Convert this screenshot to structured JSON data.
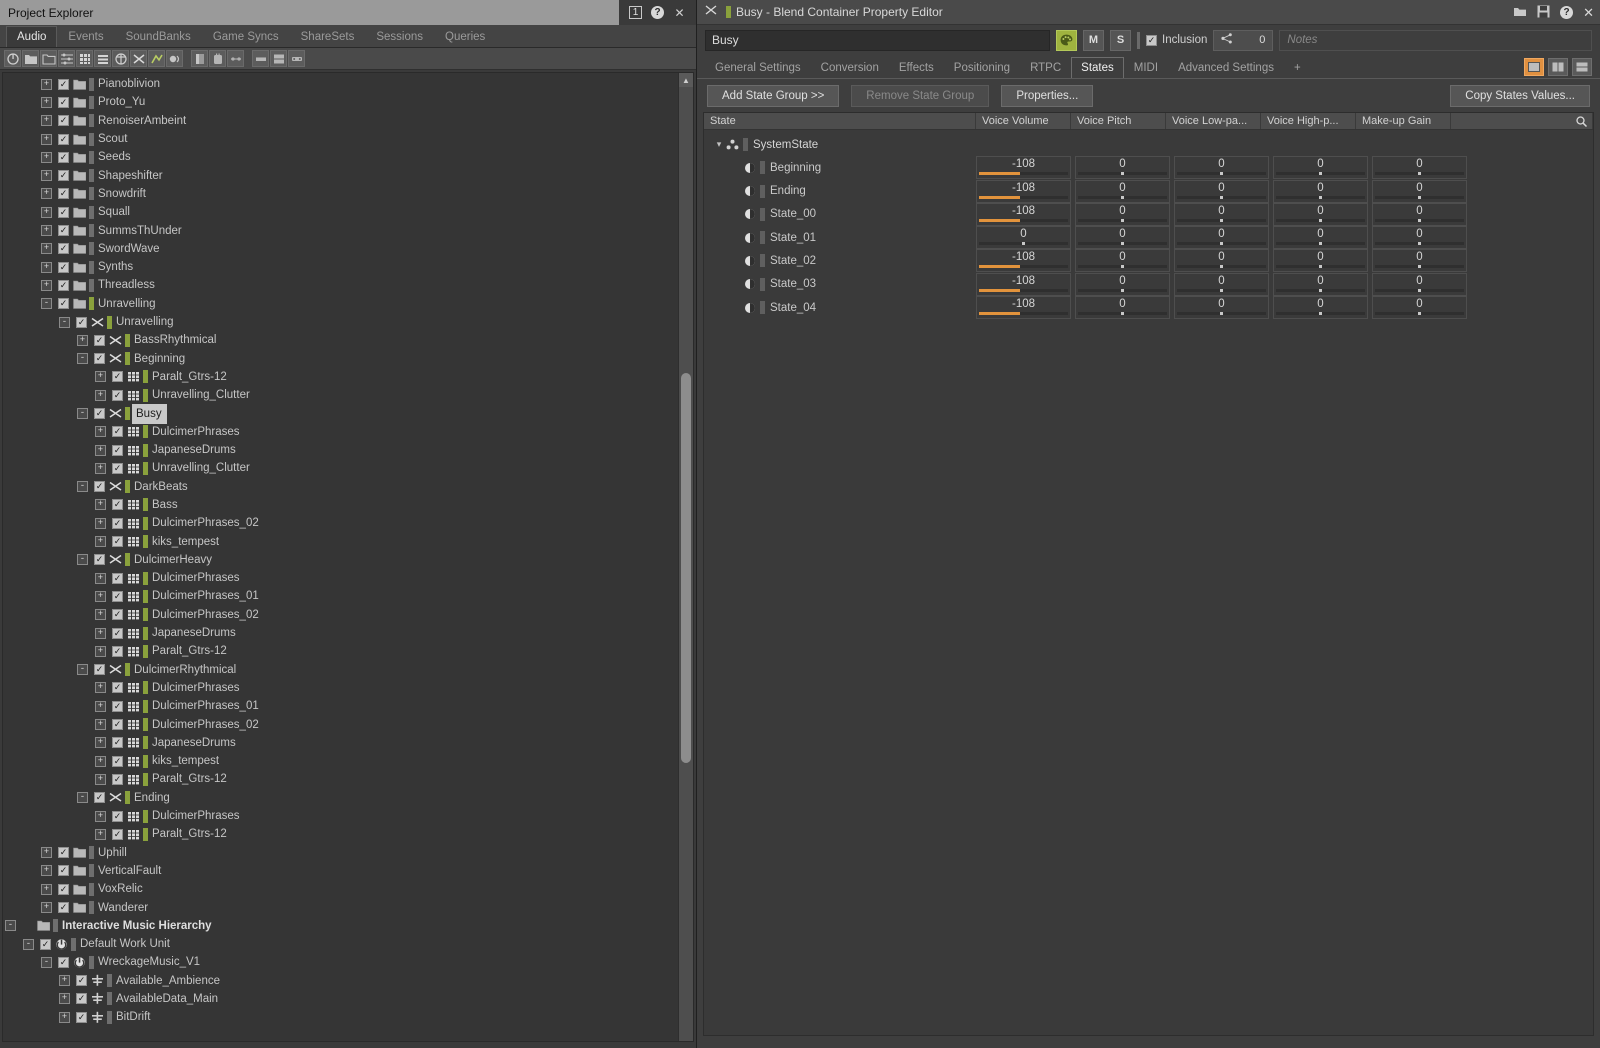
{
  "project_explorer": {
    "title": "Project Explorer",
    "window_buttons": [
      {
        "name": "pin-number-button",
        "label": "1"
      },
      {
        "name": "help-button",
        "label": "?"
      },
      {
        "name": "close-button",
        "label": "✕"
      }
    ],
    "tabs": [
      {
        "label": "Audio",
        "active": true
      },
      {
        "label": "Events",
        "active": false
      },
      {
        "label": "SoundBanks",
        "active": false
      },
      {
        "label": "Game Syncs",
        "active": false
      },
      {
        "label": "ShareSets",
        "active": false
      },
      {
        "label": "Sessions",
        "active": false
      },
      {
        "label": "Queries",
        "active": false
      }
    ],
    "toolbar": [
      "power-icon",
      "folder-icon",
      "folder-new-icon",
      "mixer-icon",
      "grid-icon",
      "list-icon",
      "random-container-icon",
      "blend-container-icon",
      "switch-container-icon",
      "actor-mixer-icon",
      "sep",
      "bus-icon",
      "aux-bus-icon",
      "motion-icon",
      "sep2",
      "soundcaster-icon",
      "layout-icon",
      "game-object-icon"
    ],
    "tree": [
      {
        "label": "Pianoblivion",
        "depth": 3,
        "exp": "+",
        "check": true,
        "icon": "folder",
        "bar": "grey"
      },
      {
        "label": "Proto_Yu",
        "depth": 3,
        "exp": "+",
        "check": true,
        "icon": "folder",
        "bar": "grey"
      },
      {
        "label": "RenoiserAmbeint",
        "depth": 3,
        "exp": "+",
        "check": true,
        "icon": "folder",
        "bar": "grey"
      },
      {
        "label": "Scout",
        "depth": 3,
        "exp": "+",
        "check": true,
        "icon": "folder",
        "bar": "grey"
      },
      {
        "label": "Seeds",
        "depth": 3,
        "exp": "+",
        "check": true,
        "icon": "folder",
        "bar": "grey"
      },
      {
        "label": "Shapeshifter",
        "depth": 3,
        "exp": "+",
        "check": true,
        "icon": "folder",
        "bar": "grey"
      },
      {
        "label": "Snowdrift",
        "depth": 3,
        "exp": "+",
        "check": true,
        "icon": "folder",
        "bar": "grey"
      },
      {
        "label": "Squall",
        "depth": 3,
        "exp": "+",
        "check": true,
        "icon": "folder",
        "bar": "grey"
      },
      {
        "label": "SummsThUnder",
        "depth": 3,
        "exp": "+",
        "check": true,
        "icon": "folder",
        "bar": "grey"
      },
      {
        "label": "SwordWave",
        "depth": 3,
        "exp": "+",
        "check": true,
        "icon": "folder",
        "bar": "grey"
      },
      {
        "label": "Synths",
        "depth": 3,
        "exp": "+",
        "check": true,
        "icon": "folder",
        "bar": "grey"
      },
      {
        "label": "Threadless",
        "depth": 3,
        "exp": "+",
        "check": true,
        "icon": "folder",
        "bar": "grey"
      },
      {
        "label": "Unravelling",
        "depth": 3,
        "exp": "-",
        "check": true,
        "icon": "folder",
        "bar": "green"
      },
      {
        "label": "Unravelling",
        "depth": 4,
        "exp": "-",
        "check": true,
        "icon": "blend",
        "bar": "green"
      },
      {
        "label": "BassRhythmical",
        "depth": 5,
        "exp": "+",
        "check": true,
        "icon": "blend",
        "bar": "green"
      },
      {
        "label": "Beginning",
        "depth": 5,
        "exp": "-",
        "check": true,
        "icon": "blend",
        "bar": "green"
      },
      {
        "label": "Paralt_Gtrs-12",
        "depth": 6,
        "exp": "+",
        "check": true,
        "icon": "sound",
        "bar": "green"
      },
      {
        "label": "Unravelling_Clutter",
        "depth": 6,
        "exp": "+",
        "check": true,
        "icon": "sound",
        "bar": "green"
      },
      {
        "label": "Busy",
        "depth": 5,
        "exp": "-",
        "check": true,
        "icon": "blend",
        "bar": "green",
        "selected": true
      },
      {
        "label": "DulcimerPhrases",
        "depth": 6,
        "exp": "+",
        "check": true,
        "icon": "sound",
        "bar": "green"
      },
      {
        "label": "JapaneseDrums",
        "depth": 6,
        "exp": "+",
        "check": true,
        "icon": "sound",
        "bar": "green"
      },
      {
        "label": "Unravelling_Clutter",
        "depth": 6,
        "exp": "+",
        "check": true,
        "icon": "sound",
        "bar": "green"
      },
      {
        "label": "DarkBeats",
        "depth": 5,
        "exp": "-",
        "check": true,
        "icon": "blend",
        "bar": "green"
      },
      {
        "label": "Bass",
        "depth": 6,
        "exp": "+",
        "check": true,
        "icon": "sound",
        "bar": "green"
      },
      {
        "label": "DulcimerPhrases_02",
        "depth": 6,
        "exp": "+",
        "check": true,
        "icon": "sound",
        "bar": "green"
      },
      {
        "label": "kiks_tempest",
        "depth": 6,
        "exp": "+",
        "check": true,
        "icon": "sound",
        "bar": "green"
      },
      {
        "label": "DulcimerHeavy",
        "depth": 5,
        "exp": "-",
        "check": true,
        "icon": "blend",
        "bar": "green"
      },
      {
        "label": "DulcimerPhrases",
        "depth": 6,
        "exp": "+",
        "check": true,
        "icon": "sound",
        "bar": "green"
      },
      {
        "label": "DulcimerPhrases_01",
        "depth": 6,
        "exp": "+",
        "check": true,
        "icon": "sound",
        "bar": "green"
      },
      {
        "label": "DulcimerPhrases_02",
        "depth": 6,
        "exp": "+",
        "check": true,
        "icon": "sound",
        "bar": "green"
      },
      {
        "label": "JapaneseDrums",
        "depth": 6,
        "exp": "+",
        "check": true,
        "icon": "sound",
        "bar": "green"
      },
      {
        "label": "Paralt_Gtrs-12",
        "depth": 6,
        "exp": "+",
        "check": true,
        "icon": "sound",
        "bar": "green"
      },
      {
        "label": "DulcimerRhythmical",
        "depth": 5,
        "exp": "-",
        "check": true,
        "icon": "blend",
        "bar": "green"
      },
      {
        "label": "DulcimerPhrases",
        "depth": 6,
        "exp": "+",
        "check": true,
        "icon": "sound",
        "bar": "green"
      },
      {
        "label": "DulcimerPhrases_01",
        "depth": 6,
        "exp": "+",
        "check": true,
        "icon": "sound",
        "bar": "green"
      },
      {
        "label": "DulcimerPhrases_02",
        "depth": 6,
        "exp": "+",
        "check": true,
        "icon": "sound",
        "bar": "green"
      },
      {
        "label": "JapaneseDrums",
        "depth": 6,
        "exp": "+",
        "check": true,
        "icon": "sound",
        "bar": "green"
      },
      {
        "label": "kiks_tempest",
        "depth": 6,
        "exp": "+",
        "check": true,
        "icon": "sound",
        "bar": "green"
      },
      {
        "label": "Paralt_Gtrs-12",
        "depth": 6,
        "exp": "+",
        "check": true,
        "icon": "sound",
        "bar": "green"
      },
      {
        "label": "Ending",
        "depth": 5,
        "exp": "-",
        "check": true,
        "icon": "blend",
        "bar": "green"
      },
      {
        "label": "DulcimerPhrases",
        "depth": 6,
        "exp": "+",
        "check": true,
        "icon": "sound",
        "bar": "green"
      },
      {
        "label": "Paralt_Gtrs-12",
        "depth": 6,
        "exp": "+",
        "check": true,
        "icon": "sound",
        "bar": "green"
      },
      {
        "label": "Uphill",
        "depth": 3,
        "exp": "+",
        "check": true,
        "icon": "folder",
        "bar": "grey"
      },
      {
        "label": "VerticalFault",
        "depth": 3,
        "exp": "+",
        "check": true,
        "icon": "folder",
        "bar": "grey"
      },
      {
        "label": "VoxRelic",
        "depth": 3,
        "exp": "+",
        "check": true,
        "icon": "folder",
        "bar": "grey"
      },
      {
        "label": "Wanderer",
        "depth": 3,
        "exp": "+",
        "check": true,
        "icon": "folder",
        "bar": "grey"
      },
      {
        "label": "Interactive Music Hierarchy",
        "depth": 1,
        "exp": "-",
        "check": false,
        "icon": "folder",
        "bar": "grey",
        "bold": true
      },
      {
        "label": "Default Work Unit",
        "depth": 2,
        "exp": "-",
        "check": true,
        "icon": "workunit",
        "bar": "grey"
      },
      {
        "label": "WreckageMusic_V1",
        "depth": 3,
        "exp": "-",
        "check": true,
        "icon": "workunit",
        "bar": "grey"
      },
      {
        "label": "Available_Ambience",
        "depth": 4,
        "exp": "+",
        "check": true,
        "icon": "switch",
        "bar": "grey"
      },
      {
        "label": "AvailableData_Main",
        "depth": 4,
        "exp": "+",
        "check": true,
        "icon": "switch",
        "bar": "grey"
      },
      {
        "label": "BitDrift",
        "depth": 4,
        "exp": "+",
        "check": true,
        "icon": "switch",
        "bar": "grey"
      }
    ]
  },
  "property_editor": {
    "title": "Busy - Blend Container Property Editor",
    "title_icon": "blend-container-icon",
    "window_buttons": [
      {
        "name": "open-folder-button",
        "label": "folder-icon"
      },
      {
        "name": "save-button",
        "label": "save-icon"
      },
      {
        "name": "help-button",
        "label": "help-icon"
      },
      {
        "name": "close-button",
        "label": "✕"
      }
    ],
    "name_value": "Busy",
    "mute_label": "M",
    "solo_label": "S",
    "inclusion_label": "Inclusion",
    "inclusion_checked": true,
    "share_count": "0",
    "notes_placeholder": "Notes",
    "tabs": [
      {
        "label": "General Settings",
        "active": false
      },
      {
        "label": "Conversion",
        "active": false
      },
      {
        "label": "Effects",
        "active": false
      },
      {
        "label": "Positioning",
        "active": false
      },
      {
        "label": "RTPC",
        "active": false
      },
      {
        "label": "States",
        "active": true
      },
      {
        "label": "MIDI",
        "active": false
      },
      {
        "label": "Advanced Settings",
        "active": false
      },
      {
        "label": "+",
        "active": false
      }
    ],
    "view_buttons": [
      "single-pane-icon",
      "vertical-split-icon",
      "horizontal-split-icon"
    ],
    "buttons": {
      "add_state_group": "Add State Group >>",
      "remove_state_group": "Remove State Group",
      "properties": "Properties...",
      "copy_states_values": "Copy States Values..."
    },
    "table": {
      "columns": [
        "State",
        "Voice Volume",
        "Voice Pitch",
        "Voice Low-pa...",
        "Voice High-p...",
        "Make-up Gain"
      ],
      "group": {
        "label": "SystemState",
        "icon": "state-group-icon",
        "expanded": true
      },
      "rows": [
        {
          "label": "Beginning",
          "values": [
            "-108",
            "0",
            "0",
            "0",
            "0"
          ]
        },
        {
          "label": "Ending",
          "values": [
            "-108",
            "0",
            "0",
            "0",
            "0"
          ]
        },
        {
          "label": "State_00",
          "values": [
            "-108",
            "0",
            "0",
            "0",
            "0"
          ]
        },
        {
          "label": "State_01",
          "values": [
            "0",
            "0",
            "0",
            "0",
            "0"
          ]
        },
        {
          "label": "State_02",
          "values": [
            "-108",
            "0",
            "0",
            "0",
            "0"
          ]
        },
        {
          "label": "State_03",
          "values": [
            "-108",
            "0",
            "0",
            "0",
            "0"
          ]
        },
        {
          "label": "State_04",
          "values": [
            "-108",
            "0",
            "0",
            "0",
            "0"
          ]
        }
      ]
    }
  },
  "colors": {
    "accent_orange": "#e2933c",
    "accent_green": "#8aa13c",
    "palette_green": "#9fb33f",
    "panel_bg": "#3e3e3e",
    "tree_bg": "#353535"
  }
}
